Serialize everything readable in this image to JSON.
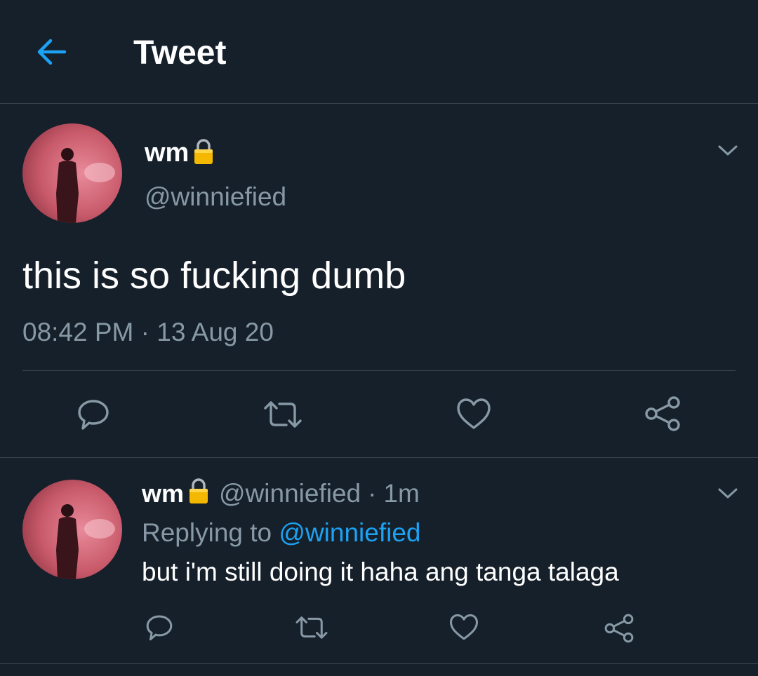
{
  "header": {
    "title": "Tweet",
    "back_icon": "back-arrow-icon"
  },
  "colors": {
    "background": "#15202b",
    "accent": "#1da1f2",
    "secondary_text": "#8899a6",
    "divider": "#38444d",
    "lock": "#f5b800"
  },
  "main_tweet": {
    "display_name": "wm",
    "lock_icon": "lock-icon",
    "handle": "@winniefied",
    "text": "this is so fucking dumb",
    "timestamp": "08:42 PM · 13 Aug 20",
    "actions": [
      "reply-icon",
      "retweet-icon",
      "like-icon",
      "share-icon"
    ]
  },
  "reply_tweet": {
    "display_name": "wm",
    "lock_icon": "lock-icon",
    "handle": "@winniefied",
    "separator": "·",
    "age": "1m",
    "replying_prefix": "Replying to",
    "replying_to": "@winniefied",
    "text": "but i'm still doing it haha ang tanga talaga",
    "actions": [
      "reply-icon",
      "retweet-icon",
      "like-icon",
      "share-icon"
    ]
  }
}
